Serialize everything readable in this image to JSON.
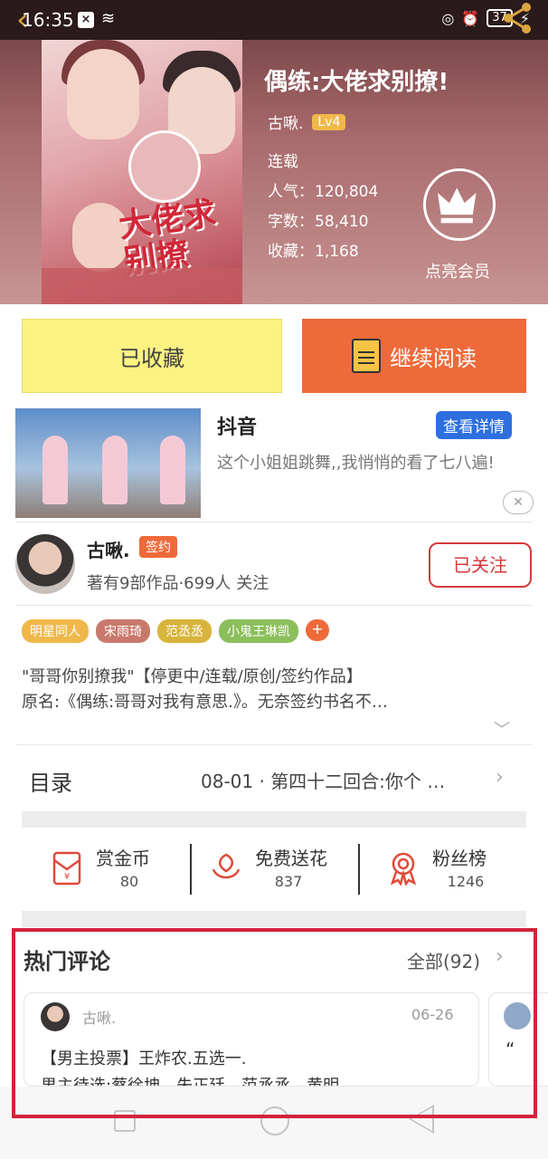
{
  "status_bar": {
    "time": "16:35",
    "battery": "37"
  },
  "book": {
    "title": "偶练:大佬求别撩!",
    "cover_title": "大佬求别撩",
    "author": "古啾.",
    "level": "Lv4",
    "status": "连载",
    "popularity_label": "人气：",
    "popularity": "120,804",
    "word_count_label": "字数：",
    "word_count": "58,410",
    "favorites_label": "收藏：",
    "favorites": "1,168",
    "vip_label": "点亮会员"
  },
  "actions": {
    "collected_label": "已收藏",
    "continue_label": "继续阅读"
  },
  "ad": {
    "title": "抖音",
    "detail_button": "查看详情",
    "description": "这个小姐姐跳舞,,我悄悄的看了七八遍!",
    "close": "✕"
  },
  "author_card": {
    "name": "古啾.",
    "badge": "签约",
    "stats": "著有9部作品·699人 关注",
    "follow_button": "已关注"
  },
  "tags": [
    {
      "label": "明星同人",
      "color": "#f0b84a"
    },
    {
      "label": "宋雨琦",
      "color": "#c9796b"
    },
    {
      "label": "范丞丞",
      "color": "#d9b43c"
    },
    {
      "label": "小鬼王琳凯",
      "color": "#8cbf5c"
    }
  ],
  "tag_add": "+",
  "description": {
    "line1": "\"哥哥你别撩我\"【停更中/连载/原创/签约作品】",
    "line2": "原名:《偶练:哥哥对我有意思.》。无奈签约书名不…"
  },
  "toc": {
    "label": "目录",
    "latest": "08-01 · 第四十二回合:你个 …"
  },
  "rewards": [
    {
      "name": "赏金币",
      "value": "80",
      "icon": "red-envelope-icon"
    },
    {
      "name": "免费送花",
      "value": "837",
      "icon": "flower-icon"
    },
    {
      "name": "粉丝榜",
      "value": "1246",
      "icon": "medal-icon"
    }
  ],
  "comments": {
    "title": "热门评论",
    "all_label": "全部(92)",
    "items": [
      {
        "user": "古啾.",
        "date": "06-26",
        "line1": "【男主投票】王炸农.五选一.",
        "line2": "男主待选:蔡徐坤、朱正廷、范丞丞、黄明"
      },
      {
        "quote": "“"
      }
    ]
  },
  "colors": {
    "accent": "#ef6a3a",
    "collected_bg": "#fbf282",
    "highlight": "#d3233a",
    "detail_blue": "#2e6fe0"
  }
}
